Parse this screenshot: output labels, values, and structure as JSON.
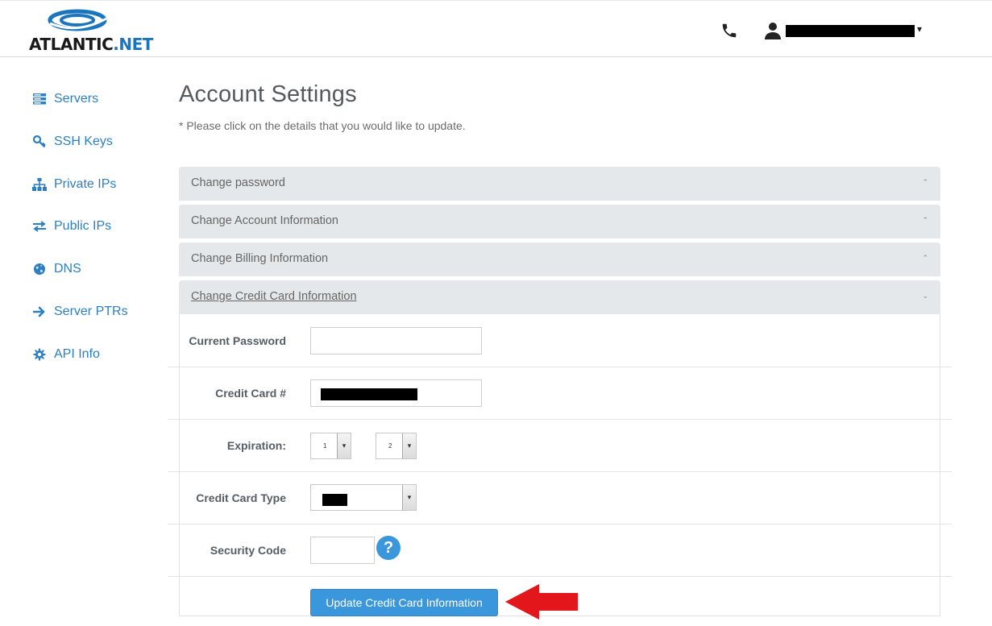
{
  "header": {
    "logo_text_main": "ATLANTIC",
    "logo_text_dot": ".NET",
    "phone_icon": "phone-icon",
    "user_icon": "user-icon",
    "user_name": "account-user",
    "user_caret": "▾"
  },
  "sidebar": {
    "items": [
      {
        "label": "Servers",
        "icon": "server-icon"
      },
      {
        "label": "SSH Keys",
        "icon": "key-icon"
      },
      {
        "label": "Private IPs",
        "icon": "network-icon"
      },
      {
        "label": "Public IPs",
        "icon": "exchange-icon"
      },
      {
        "label": "DNS",
        "icon": "globe-icon"
      },
      {
        "label": "Server PTRs",
        "icon": "arrow-right-icon"
      },
      {
        "label": "API Info",
        "icon": "gear-icon"
      }
    ]
  },
  "main": {
    "title": "Account Settings",
    "subtitle": "* Please click on the details that you would like to update.",
    "sections": [
      {
        "label": "Change password",
        "chevron": "⌃",
        "open": false
      },
      {
        "label": "Change Account Information",
        "chevron": "⌃",
        "open": false
      },
      {
        "label": "Change Billing Information",
        "chevron": "⌃",
        "open": false
      },
      {
        "label": "Change Credit Card Information",
        "chevron": "⌄",
        "open": true
      }
    ],
    "form": {
      "current_password_label": "Current Password",
      "current_password_value": "",
      "credit_card_label": "Credit Card #",
      "credit_card_value": "redacted",
      "expiration_label": "Expiration:",
      "expiration_month": "1",
      "expiration_year": "2",
      "card_type_label": "Credit Card Type",
      "card_type_value": "redacted",
      "security_code_label": "Security Code",
      "security_code_value": "",
      "help_glyph": "?",
      "submit_label": "Update Credit Card Information"
    }
  },
  "colors": {
    "accent": "#3a97dc",
    "link": "#2d7fc1",
    "accordion_bg": "#e4e8eb",
    "annotation_arrow": "#e3161b"
  }
}
